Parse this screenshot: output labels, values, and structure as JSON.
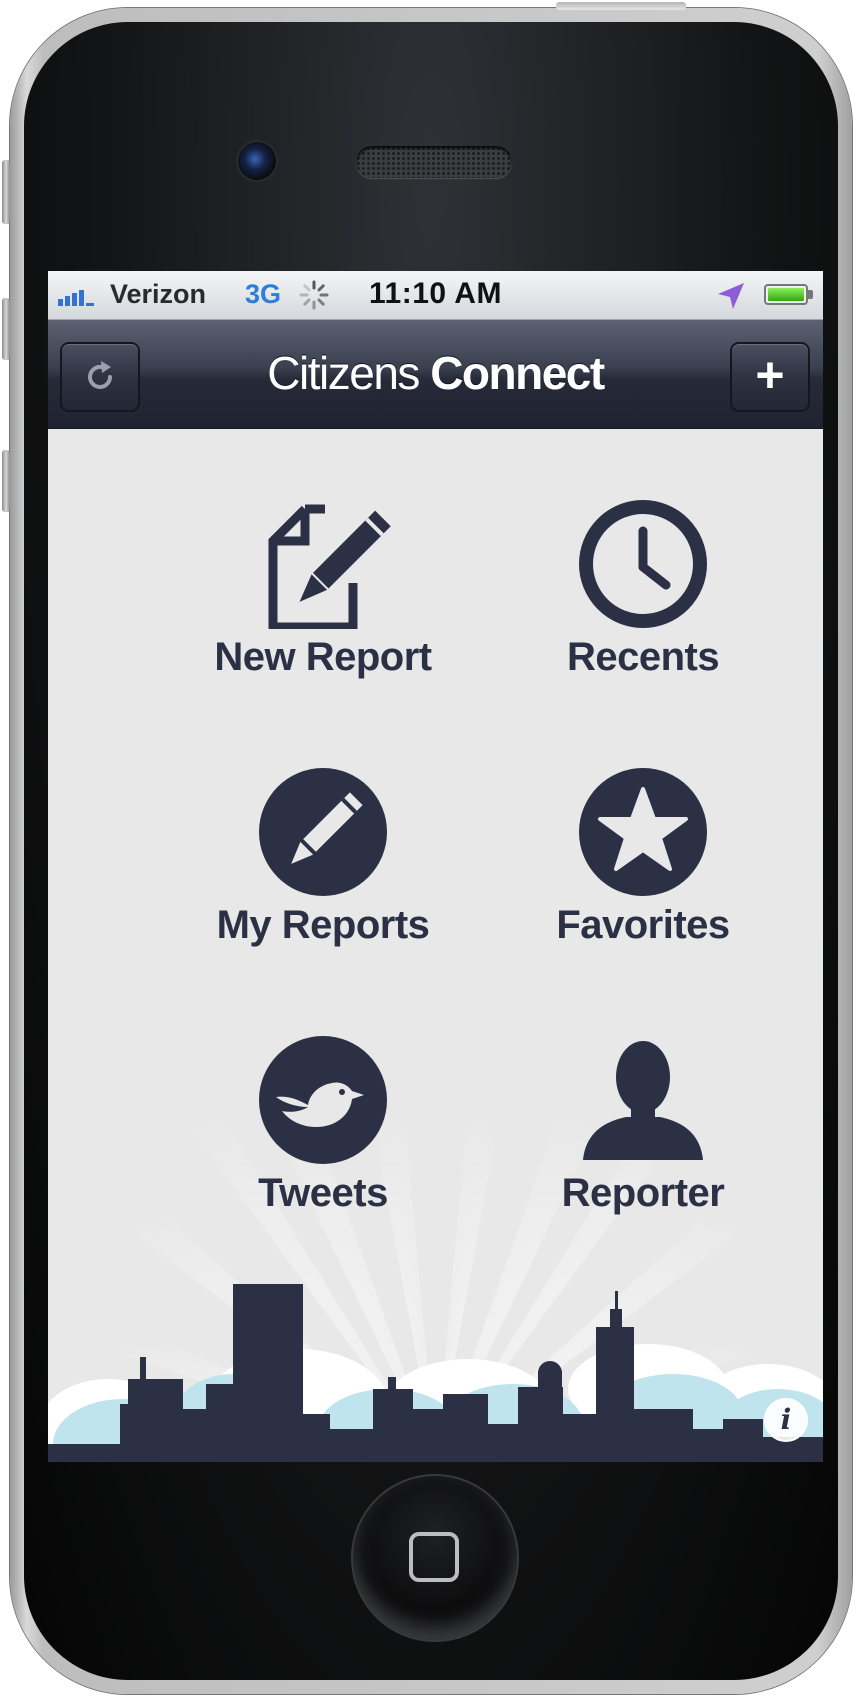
{
  "status_bar": {
    "carrier": "Verizon",
    "network": "3G",
    "time": "11:10 AM",
    "icons": [
      "signal-bars-icon",
      "activity-spinner-icon",
      "location-arrow-icon",
      "battery-icon"
    ],
    "battery_level": 0.9
  },
  "nav_bar": {
    "title_light": "Citizens",
    "title_bold": "Connect",
    "left_button_icon": "refresh-icon",
    "right_button_label": "+"
  },
  "menu": {
    "items": [
      {
        "label": "New Report",
        "icon": "new-report-icon"
      },
      {
        "label": "Recents",
        "icon": "clock-icon"
      },
      {
        "label": "My Reports",
        "icon": "pencil-circle-icon"
      },
      {
        "label": "Favorites",
        "icon": "star-icon"
      },
      {
        "label": "Tweets",
        "icon": "bird-icon"
      },
      {
        "label": "Reporter",
        "icon": "person-icon"
      }
    ]
  },
  "footer": {
    "info_label": "i",
    "decoration": "city-skyline"
  },
  "colors": {
    "icon_navy": "#2b3044",
    "nav_bar_dark": "#272b38",
    "screen_bg": "#e8e8e9",
    "sky_blue": "#bfe4ee"
  }
}
